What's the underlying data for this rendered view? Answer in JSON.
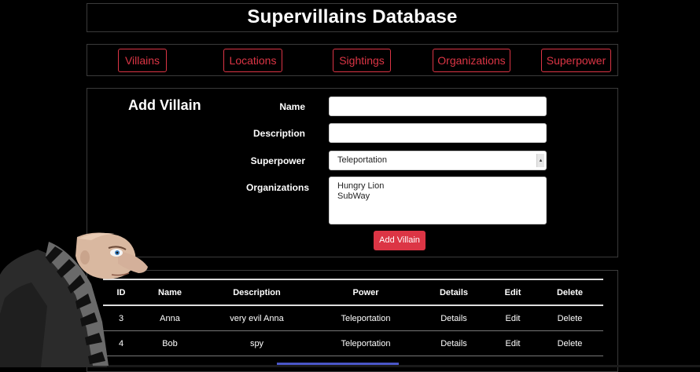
{
  "header": {
    "title": "Supervillains Database"
  },
  "nav": [
    {
      "label": "Villains"
    },
    {
      "label": "Locations"
    },
    {
      "label": "Sightings"
    },
    {
      "label": "Organizations"
    },
    {
      "label": "Superpower"
    }
  ],
  "form": {
    "title": "Add Villain",
    "name_label": "Name",
    "name_value": "",
    "description_label": "Description",
    "description_value": "",
    "superpower_label": "Superpower",
    "superpower_selected": "Teleportation",
    "organizations_label": "Organizations",
    "organizations_options": [
      "Hungry Lion",
      "SubWay"
    ],
    "submit_label": "Add Villain"
  },
  "table": {
    "headers": [
      "ID",
      "Name",
      "Description",
      "Power",
      "Details",
      "Edit",
      "Delete"
    ],
    "rows": [
      [
        "3",
        "Anna",
        "very evil Anna",
        "Teleportation",
        "Details",
        "Edit",
        "Delete"
      ],
      [
        "4",
        "Bob",
        "spy",
        "Teleportation",
        "Details",
        "Edit",
        "Delete"
      ]
    ]
  },
  "colors": {
    "accent": "#dc3545",
    "background": "#000000",
    "text": "#ffffff"
  }
}
